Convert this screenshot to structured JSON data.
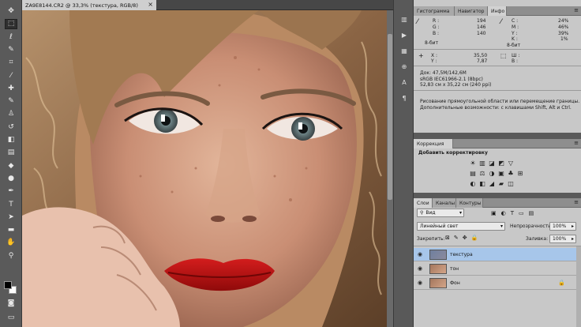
{
  "document": {
    "tab_title": "ZA9E8144.CR2 @ 33,3% (текстура, RGB/8)",
    "close": "×"
  },
  "tools": [
    {
      "icon": "move-icon",
      "glyph": "✥"
    },
    {
      "icon": "marquee-icon",
      "glyph": "⬚"
    },
    {
      "icon": "lasso-icon",
      "glyph": "ℓ"
    },
    {
      "icon": "quick-select-icon",
      "glyph": "✎"
    },
    {
      "icon": "crop-icon",
      "glyph": "⌗"
    },
    {
      "icon": "eyedropper-icon",
      "glyph": "⁄"
    },
    {
      "icon": "healing-brush-icon",
      "glyph": "✚"
    },
    {
      "icon": "brush-icon",
      "glyph": "✎"
    },
    {
      "icon": "clone-stamp-icon",
      "glyph": "♙"
    },
    {
      "icon": "history-brush-icon",
      "glyph": "↺"
    },
    {
      "icon": "eraser-icon",
      "glyph": "◧"
    },
    {
      "icon": "gradient-icon",
      "glyph": "▤"
    },
    {
      "icon": "blur-icon",
      "glyph": "◆"
    },
    {
      "icon": "dodge-icon",
      "glyph": "●"
    },
    {
      "icon": "pen-icon",
      "glyph": "✒"
    },
    {
      "icon": "type-icon",
      "glyph": "T"
    },
    {
      "icon": "path-select-icon",
      "glyph": "➤"
    },
    {
      "icon": "shape-icon",
      "glyph": "▬"
    },
    {
      "icon": "hand-icon",
      "glyph": "✋"
    },
    {
      "icon": "zoom-icon",
      "glyph": "⚲"
    }
  ],
  "colors": {
    "foreground": "#000000",
    "background": "#ffffff",
    "selection": "#a7c6ea",
    "panel_bg": "#c8c8c8"
  },
  "right_strip": [
    {
      "icon": "histogram-icon",
      "glyph": "▥"
    },
    {
      "icon": "play-icon",
      "glyph": "▶"
    },
    {
      "icon": "brush-preset-icon",
      "glyph": "▦"
    },
    {
      "icon": "clone-source-icon",
      "glyph": "⊕"
    },
    {
      "icon": "character-icon",
      "glyph": "A"
    },
    {
      "icon": "paragraph-icon",
      "glyph": "¶"
    }
  ],
  "info_panel": {
    "tabs": [
      "Гистограмма",
      "Навигатор",
      "Инфо"
    ],
    "menu": "≡",
    "rgb": {
      "R": "194",
      "G": "146",
      "B": "140",
      "bits": "8-бит"
    },
    "cmyk": {
      "C": "24%",
      "M": "46%",
      "Y": "39%",
      "K": "1%",
      "bits": "8-бит"
    },
    "xy": {
      "X_label": "X :",
      "X": "35,50",
      "Y_label": "Y :",
      "Y": "7,87"
    },
    "wh": {
      "W_label": "Ш :",
      "H_label": "В :"
    },
    "doc": "Док: 47,5M/142,6M",
    "profile": "sRGB IEC61966-2.1 (8bpc)",
    "size": "52,83 см x 35,22 см (240 ppi)",
    "hint1": "Рисование прямоугольной области или перемещение границы.",
    "hint2": "Дополнительные возможности: с клавишами Shift, Alt и Ctrl."
  },
  "adjustments_panel": {
    "tab": "Коррекция",
    "title": "Добавить корректировку",
    "row1": [
      "☀",
      "▥",
      "◪",
      "◩",
      "▽"
    ],
    "row2": [
      "▤",
      "⚖",
      "◑",
      "▣",
      "♣",
      "⊞"
    ],
    "row3": [
      "◐",
      "◧",
      "◢",
      "▰",
      "◫"
    ]
  },
  "layers_panel": {
    "tabs": [
      "Слои",
      "Каналы",
      "Контуры"
    ],
    "filter_label": "Вид",
    "blend_mode": "Линейный свет",
    "opacity_label": "Непрозрачность:",
    "opacity_value": "100%",
    "lock_label": "Закрепить:",
    "fill_label": "Заливка:",
    "fill_value": "100%",
    "layers": [
      {
        "name": "текстура",
        "selected": true
      },
      {
        "name": "тон",
        "selected": false
      },
      {
        "name": "Фон",
        "selected": false,
        "locked": true
      }
    ]
  }
}
